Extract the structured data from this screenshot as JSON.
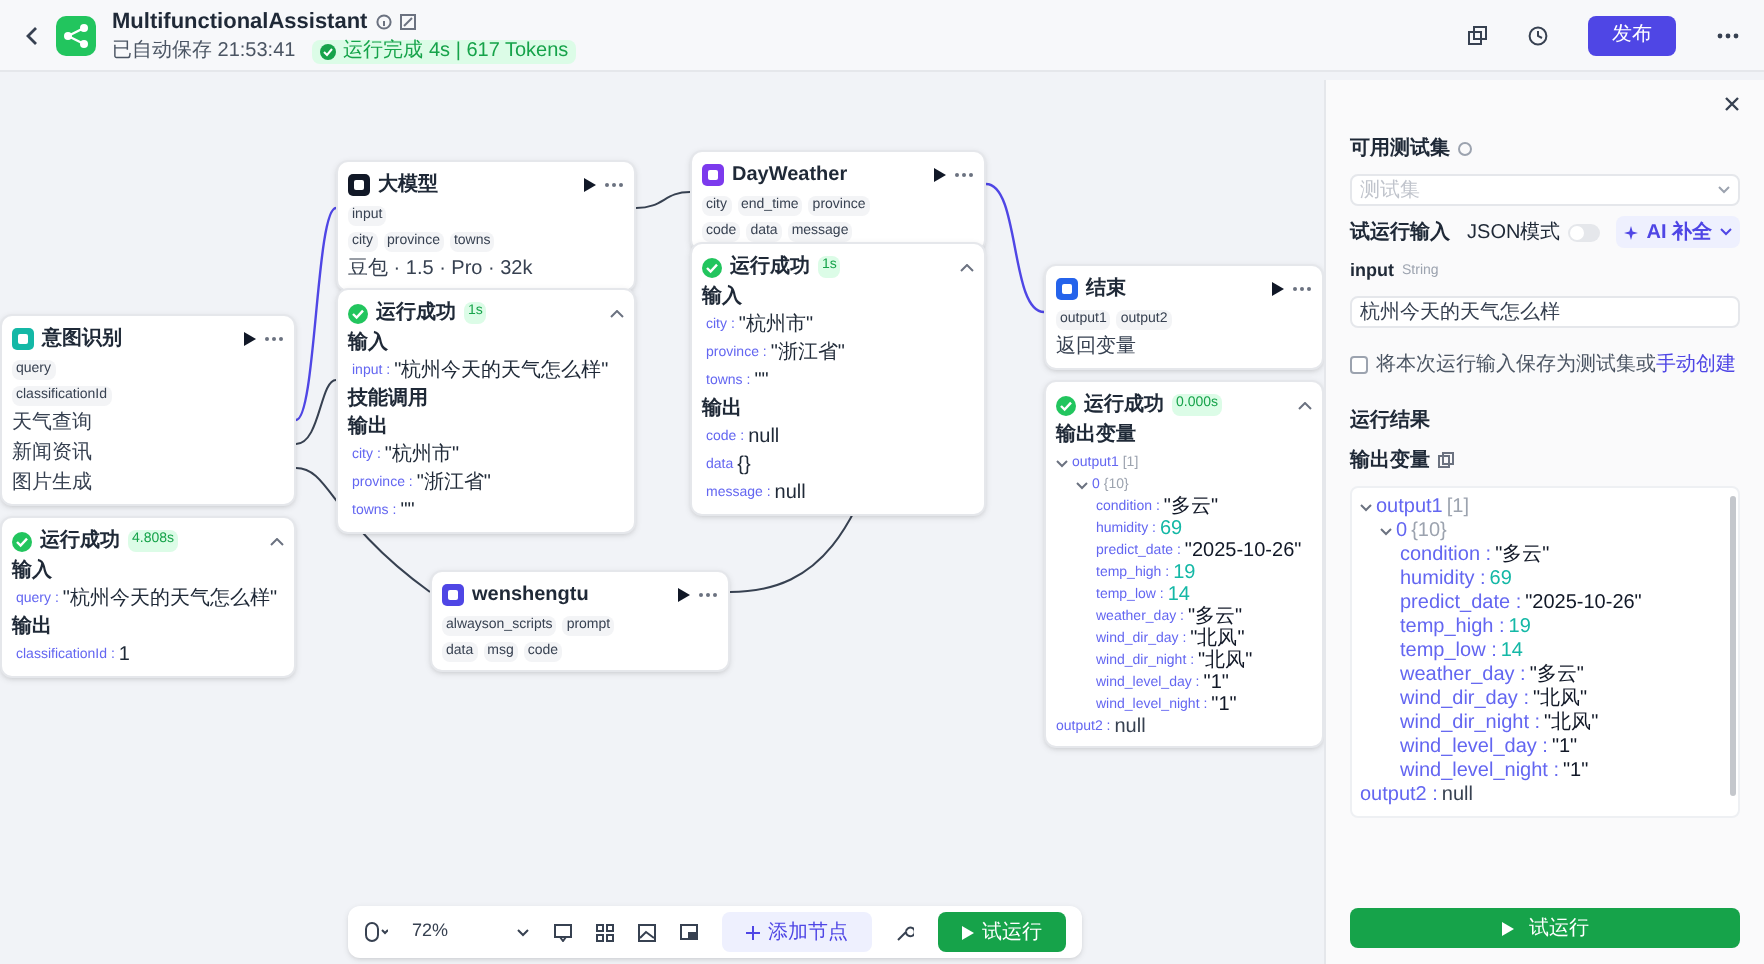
{
  "header": {
    "title": "MultifunctionalAssistant",
    "autosave": "已自动保存 21:53:41",
    "run_status": "运行完成 4s | 617 Tokens",
    "publish_button": "发布"
  },
  "nodes": [
    {
      "title": "意图识别",
      "color": "#14b8a6",
      "inputs": [
        "query"
      ],
      "outputs": [
        "classificationId"
      ],
      "lines": [
        "天气查询",
        "新闻资讯",
        "图片生成"
      ],
      "result": {
        "status": "运行成功",
        "time": "4.808s",
        "sections": [
          {
            "heading": "输入",
            "items": [
              {
                "key": "query :",
                "value": "\"杭州今天的天气怎么样\""
              }
            ]
          },
          {
            "heading": "输出",
            "items": [
              {
                "key": "classificationId :",
                "value": "1"
              }
            ]
          }
        ]
      }
    },
    {
      "title": "大模型",
      "color": "#111827",
      "inputs": [
        "input"
      ],
      "outputs": [
        "city",
        "province",
        "towns"
      ],
      "lines": [
        "豆包 · 1.5 · Pro · 32k"
      ],
      "result": {
        "status": "运行成功",
        "time": "1s",
        "sections": [
          {
            "heading": "输入",
            "items": [
              {
                "key": "input :",
                "value": "\"杭州今天的天气怎么样\""
              }
            ]
          },
          {
            "heading": "技能调用"
          },
          {
            "heading": "输出",
            "items": [
              {
                "key": "city :",
                "value": "\"杭州市\""
              },
              {
                "key": "province :",
                "value": "\"浙江省\""
              },
              {
                "key": "towns :",
                "value": "\"\""
              }
            ]
          }
        ]
      }
    },
    {
      "title": "DayWeather",
      "color": "#7c3aed",
      "inputs": [
        "city",
        "end_time",
        "province"
      ],
      "outputs": [
        "code",
        "data",
        "message"
      ],
      "result": {
        "status": "运行成功",
        "time": "1s",
        "sections": [
          {
            "heading": "输入",
            "items": [
              {
                "key": "city :",
                "value": "\"杭州市\""
              },
              {
                "key": "province :",
                "value": "\"浙江省\""
              },
              {
                "key": "towns :",
                "value": "\"\""
              }
            ]
          },
          {
            "heading": "输出",
            "items": [
              {
                "key": "code :",
                "value": "null"
              },
              {
                "key": "data",
                "value": "{}"
              },
              {
                "key": "message :",
                "value": "null"
              }
            ]
          }
        ]
      }
    },
    {
      "title": "wenshengtu",
      "color": "#4f46e5",
      "inputs": [
        "alwayson_scripts",
        "prompt"
      ],
      "outputs": [
        "data",
        "msg",
        "code"
      ]
    },
    {
      "title": "结束",
      "color": "#2563eb",
      "inputs": [
        "output1",
        "output2"
      ],
      "lines": [
        "返回变量"
      ],
      "result": {
        "status": "运行成功",
        "time": "0.000s",
        "heading": "输出变量",
        "tree": [
          {
            "key": "output1",
            "meta": "[1]",
            "expanded": true,
            "children": [
              {
                "key": "0",
                "meta": "{10}",
                "expanded": true,
                "children": [
                  {
                    "key": "condition :",
                    "value": "\"多云\"",
                    "kind": "string"
                  },
                  {
                    "key": "humidity :",
                    "value": "69",
                    "kind": "number"
                  },
                  {
                    "key": "predict_date :",
                    "value": "\"2025-10-26\"",
                    "kind": "string"
                  },
                  {
                    "key": "temp_high :",
                    "value": "19",
                    "kind": "number"
                  },
                  {
                    "key": "temp_low :",
                    "value": "14",
                    "kind": "number"
                  },
                  {
                    "key": "weather_day :",
                    "value": "\"多云\"",
                    "kind": "string"
                  },
                  {
                    "key": "wind_dir_day :",
                    "value": "\"北风\"",
                    "kind": "string"
                  },
                  {
                    "key": "wind_dir_night :",
                    "value": "\"北风\"",
                    "kind": "string"
                  },
                  {
                    "key": "wind_level_day :",
                    "value": "\"1\"",
                    "kind": "string"
                  },
                  {
                    "key": "wind_level_night :",
                    "value": "\"1\"",
                    "kind": "string"
                  }
                ]
              }
            ]
          },
          {
            "key": "output2 :",
            "value": "null",
            "kind": "null"
          }
        ]
      }
    }
  ],
  "panel": {
    "testset_label": "可用测试集",
    "testset_placeholder": "测试集",
    "input_heading": "试运行输入",
    "json_mode": {
      "label": "JSON模式",
      "on": false
    },
    "ai_button": "AI 补全",
    "field": {
      "name": "input",
      "type": "String",
      "value": "杭州今天的天气怎么样"
    },
    "save": {
      "checked": false,
      "text": "将本次运行输入保存为测试集或",
      "link": "手动创建"
    },
    "result_heading": "运行结果",
    "output_heading": "输出变量",
    "tree": [
      {
        "key": "output1",
        "meta": "[1]",
        "expanded": true,
        "children": [
          {
            "key": "0",
            "meta": "{10}",
            "expanded": true,
            "children": [
              {
                "key": "condition :",
                "value": "\"多云\"",
                "kind": "string"
              },
              {
                "key": "humidity :",
                "value": "69",
                "kind": "number"
              },
              {
                "key": "predict_date :",
                "value": "\"2025-10-26\"",
                "kind": "string"
              },
              {
                "key": "temp_high :",
                "value": "19",
                "kind": "number"
              },
              {
                "key": "temp_low :",
                "value": "14",
                "kind": "number"
              },
              {
                "key": "weather_day :",
                "value": "\"多云\"",
                "kind": "string"
              },
              {
                "key": "wind_dir_day :",
                "value": "\"北风\"",
                "kind": "string"
              },
              {
                "key": "wind_dir_night :",
                "value": "\"北风\"",
                "kind": "string"
              },
              {
                "key": "wind_level_day :",
                "value": "\"1\"",
                "kind": "string"
              },
              {
                "key": "wind_level_night :",
                "value": "\"1\"",
                "kind": "string"
              }
            ]
          }
        ]
      },
      {
        "key": "output2 :",
        "value": "null",
        "kind": "null"
      }
    ],
    "run_button": "试运行"
  },
  "toolbar": {
    "zoom": "72%",
    "add_node": "添加节点",
    "run_button": "试运行"
  }
}
